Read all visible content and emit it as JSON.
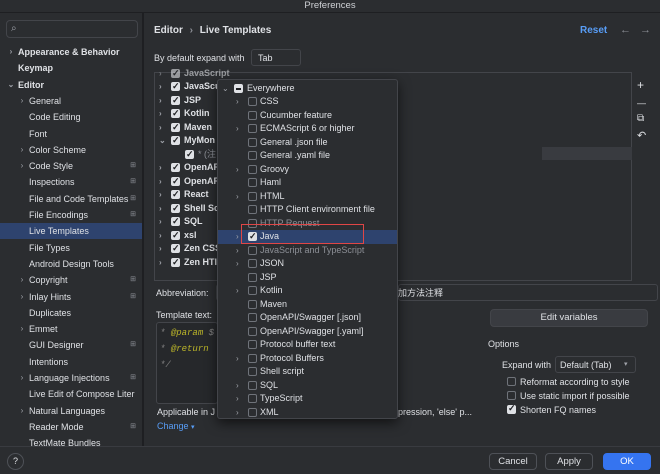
{
  "window": {
    "title": "Preferences"
  },
  "search": {
    "placeholder": ""
  },
  "sidebar": {
    "items": [
      {
        "label": "Appearance & Behavior",
        "chevron": "right",
        "bold": true,
        "indent": 0,
        "badge": ""
      },
      {
        "label": "Keymap",
        "chevron": "",
        "bold": true,
        "indent": 0,
        "badge": ""
      },
      {
        "label": "Editor",
        "chevron": "down",
        "bold": true,
        "indent": 0,
        "badge": ""
      },
      {
        "label": "General",
        "chevron": "right",
        "bold": false,
        "indent": 1,
        "badge": ""
      },
      {
        "label": "Code Editing",
        "chevron": "",
        "bold": false,
        "indent": 1,
        "badge": ""
      },
      {
        "label": "Font",
        "chevron": "",
        "bold": false,
        "indent": 1,
        "badge": ""
      },
      {
        "label": "Color Scheme",
        "chevron": "right",
        "bold": false,
        "indent": 1,
        "badge": ""
      },
      {
        "label": "Code Style",
        "chevron": "right",
        "bold": false,
        "indent": 1,
        "badge": "⊞"
      },
      {
        "label": "Inspections",
        "chevron": "",
        "bold": false,
        "indent": 1,
        "badge": "⊞"
      },
      {
        "label": "File and Code Templates",
        "chevron": "",
        "bold": false,
        "indent": 1,
        "badge": "⊞"
      },
      {
        "label": "File Encodings",
        "chevron": "",
        "bold": false,
        "indent": 1,
        "badge": "⊞"
      },
      {
        "label": "Live Templates",
        "chevron": "",
        "bold": false,
        "indent": 1,
        "badge": "",
        "selected": true
      },
      {
        "label": "File Types",
        "chevron": "",
        "bold": false,
        "indent": 1,
        "badge": ""
      },
      {
        "label": "Android Design Tools",
        "chevron": "",
        "bold": false,
        "indent": 1,
        "badge": ""
      },
      {
        "label": "Copyright",
        "chevron": "right",
        "bold": false,
        "indent": 1,
        "badge": "⊞"
      },
      {
        "label": "Inlay Hints",
        "chevron": "right",
        "bold": false,
        "indent": 1,
        "badge": "⊞"
      },
      {
        "label": "Duplicates",
        "chevron": "",
        "bold": false,
        "indent": 1,
        "badge": ""
      },
      {
        "label": "Emmet",
        "chevron": "right",
        "bold": false,
        "indent": 1,
        "badge": ""
      },
      {
        "label": "GUI Designer",
        "chevron": "",
        "bold": false,
        "indent": 1,
        "badge": "⊞"
      },
      {
        "label": "Intentions",
        "chevron": "",
        "bold": false,
        "indent": 1,
        "badge": ""
      },
      {
        "label": "Language Injections",
        "chevron": "right",
        "bold": false,
        "indent": 1,
        "badge": "⊞"
      },
      {
        "label": "Live Edit of Compose Liter",
        "chevron": "",
        "bold": false,
        "indent": 1,
        "badge": ""
      },
      {
        "label": "Natural Languages",
        "chevron": "right",
        "bold": false,
        "indent": 1,
        "badge": ""
      },
      {
        "label": "Reader Mode",
        "chevron": "",
        "bold": false,
        "indent": 1,
        "badge": "⊞"
      },
      {
        "label": "TextMate Bundles",
        "chevron": "",
        "bold": false,
        "indent": 1,
        "badge": ""
      }
    ]
  },
  "header": {
    "breadcrumb_root": "Editor",
    "breadcrumb_sep": "›",
    "breadcrumb_leaf": "Live Templates",
    "reset_label": "Reset",
    "back_arrow": "←",
    "forward_arrow": "→"
  },
  "expand": {
    "label": "By default expand with",
    "value": "Tab"
  },
  "template_groups": [
    {
      "label": "JavaScript",
      "chevron": "right",
      "checked": true,
      "clipped": true
    },
    {
      "label": "JavaScu",
      "chevron": "right",
      "checked": true
    },
    {
      "label": "JSP",
      "chevron": "right",
      "checked": true
    },
    {
      "label": "Kotlin",
      "chevron": "right",
      "checked": true
    },
    {
      "label": "Maven",
      "chevron": "right",
      "checked": true
    },
    {
      "label": "MyMon",
      "chevron": "down",
      "checked": true
    },
    {
      "label": "* (注",
      "chevron": "",
      "checked": true,
      "child": true
    },
    {
      "label": "OpenAP",
      "chevron": "right",
      "checked": true
    },
    {
      "label": "OpenAP",
      "chevron": "right",
      "checked": true
    },
    {
      "label": "React",
      "chevron": "right",
      "checked": true
    },
    {
      "label": "Shell Sc",
      "chevron": "right",
      "checked": true
    },
    {
      "label": "SQL",
      "chevron": "right",
      "checked": true
    },
    {
      "label": "xsl",
      "chevron": "right",
      "checked": true
    },
    {
      "label": "Zen CSS",
      "chevron": "right",
      "checked": true
    },
    {
      "label": "Zen HTI",
      "chevron": "right",
      "checked": true
    }
  ],
  "toolbar_icons": [
    "plus-icon",
    "minus-icon",
    "copy-icon",
    "undo-icon"
  ],
  "toolbar_glyphs": {
    "plus": "+",
    "minus": "—",
    "copy": "⧉",
    "undo": "↶"
  },
  "context_popup": {
    "header": "Everywhere",
    "items": [
      {
        "label": "CSS",
        "chevron": true,
        "checked": false
      },
      {
        "label": "Cucumber feature",
        "chevron": false,
        "checked": false
      },
      {
        "label": "ECMAScript 6 or higher",
        "chevron": true,
        "checked": false
      },
      {
        "label": "General .json file",
        "chevron": false,
        "checked": false
      },
      {
        "label": "General .yaml file",
        "chevron": false,
        "checked": false
      },
      {
        "label": "Groovy",
        "chevron": true,
        "checked": false
      },
      {
        "label": "Haml",
        "chevron": false,
        "checked": false
      },
      {
        "label": "HTML",
        "chevron": true,
        "checked": false
      },
      {
        "label": "HTTP Client environment file",
        "chevron": false,
        "checked": false
      },
      {
        "label": "HTTP Request",
        "chevron": false,
        "checked": false,
        "strike": true
      },
      {
        "label": "Java",
        "chevron": true,
        "checked": true,
        "selected": true
      },
      {
        "label": "JavaScript and TypeScript",
        "chevron": true,
        "checked": false,
        "strike": true
      },
      {
        "label": "JSON",
        "chevron": true,
        "checked": false
      },
      {
        "label": "JSP",
        "chevron": false,
        "checked": false
      },
      {
        "label": "Kotlin",
        "chevron": true,
        "checked": false
      },
      {
        "label": "Maven",
        "chevron": false,
        "checked": false
      },
      {
        "label": "OpenAPI/Swagger [.json]",
        "chevron": false,
        "checked": false
      },
      {
        "label": "OpenAPI/Swagger [.yaml]",
        "chevron": false,
        "checked": false
      },
      {
        "label": "Protocol buffer text",
        "chevron": false,
        "checked": false
      },
      {
        "label": "Protocol Buffers",
        "chevron": true,
        "checked": false
      },
      {
        "label": "Shell script",
        "chevron": false,
        "checked": false
      },
      {
        "label": "SQL",
        "chevron": true,
        "checked": false
      },
      {
        "label": "TypeScript",
        "chevron": true,
        "checked": false
      },
      {
        "label": "XML",
        "chevron": true,
        "checked": false
      }
    ]
  },
  "abbreviation": {
    "label": "Abbreviation:",
    "description_tail": "法加方法注释"
  },
  "template_text": {
    "label": "Template text:",
    "lines": [
      "* @param $",
      "* @return",
      "*/"
    ]
  },
  "edit_variables_label": "Edit variables",
  "options": {
    "title": "Options",
    "expand_label": "Expand with",
    "expand_value": "Default (Tab)",
    "reformat_label": "Reformat according to style",
    "reformat_checked": false,
    "static_import_label": "Use static import if possible",
    "static_import_checked": false,
    "shorten_fq_label": "Shorten FQ names",
    "shorten_fq_checked": true
  },
  "applicable": {
    "prefix": "Applicable in J",
    "suffix": "pression, 'else' p...",
    "change_label": "Change"
  },
  "footer": {
    "help_label": "?",
    "cancel_label": "Cancel",
    "apply_label": "Apply",
    "ok_label": "OK"
  },
  "colors": {
    "accent": "#3574f0",
    "selection": "#2e436e",
    "link": "#589df6",
    "highlight_box": "#e04646"
  }
}
